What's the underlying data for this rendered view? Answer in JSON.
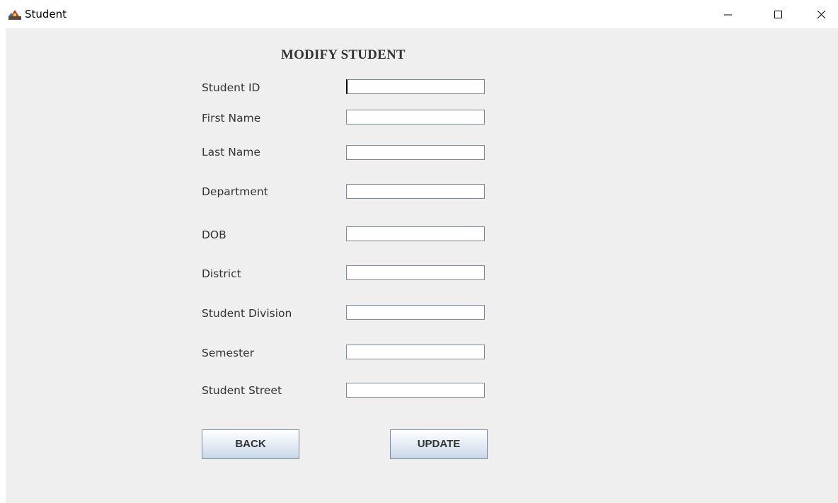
{
  "window": {
    "title": "Student",
    "icon": "java-app-icon",
    "controls": [
      "minimize-icon",
      "maximize-icon",
      "close-icon"
    ]
  },
  "form": {
    "title": "MODIFY STUDENT",
    "fields": [
      {
        "label": "Student ID",
        "value": ""
      },
      {
        "label": "First Name",
        "value": ""
      },
      {
        "label": "Last Name",
        "value": ""
      },
      {
        "label": "Department",
        "value": ""
      },
      {
        "label": "DOB",
        "value": ""
      },
      {
        "label": "District",
        "value": ""
      },
      {
        "label": "Student Division",
        "value": ""
      },
      {
        "label": "Semester",
        "value": ""
      },
      {
        "label": "Student Street",
        "value": ""
      }
    ],
    "buttons": {
      "back_label": "BACK",
      "update_label": "UPDATE"
    }
  },
  "colors": {
    "panel_background": "#efefef",
    "field_border": "#7a8a99",
    "text": "#333333"
  }
}
